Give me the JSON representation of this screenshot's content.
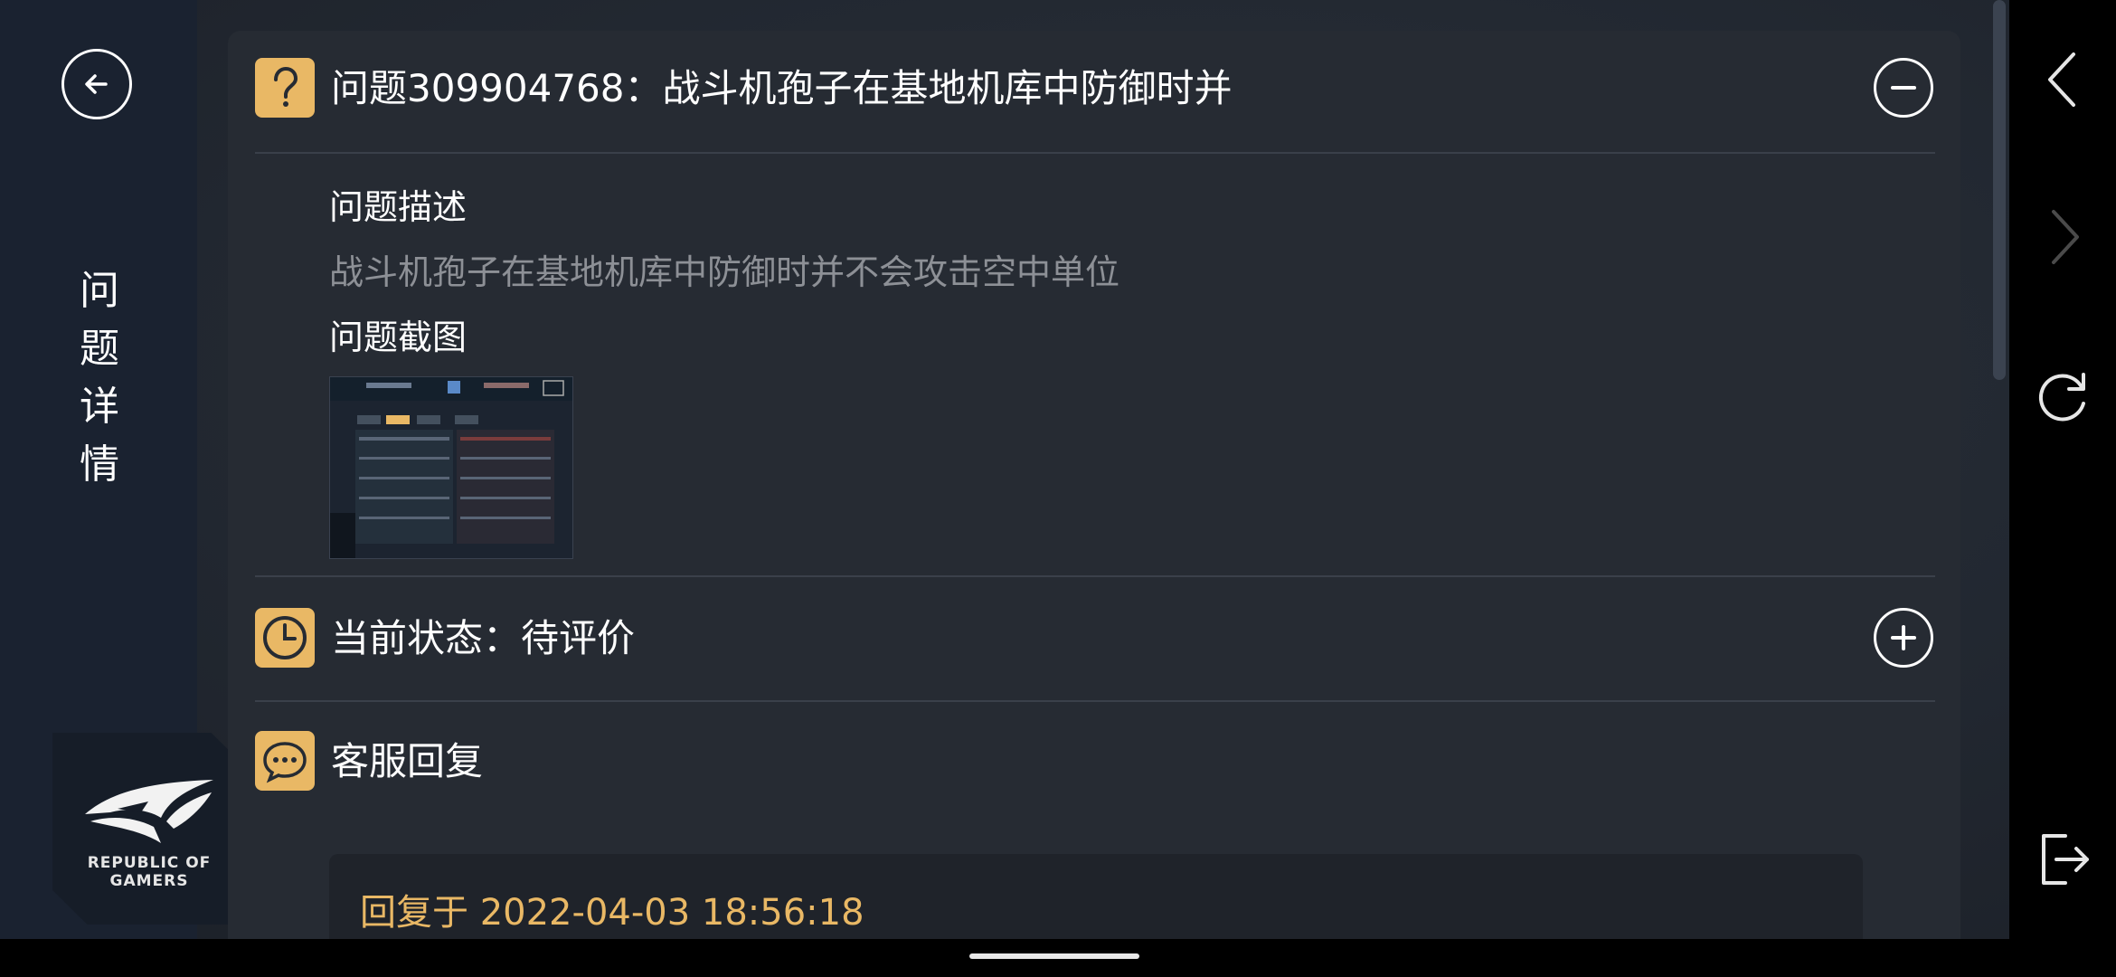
{
  "sidebar": {
    "title_chars": [
      "问",
      "题",
      "详",
      "情"
    ],
    "brand_line1": "REPUBLIC OF",
    "brand_line2": "GAMERS"
  },
  "issue": {
    "title": "问题309904768：战斗机孢子在基地机库中防御时并",
    "description_label": "问题描述",
    "description_text": "战斗机孢子在基地机库中防御时并不会攻击空中单位",
    "screenshot_label": "问题截图"
  },
  "status": {
    "text": "当前状态：待评价"
  },
  "support": {
    "title": "客服回复",
    "reply_time": "回复于 2022-04-03 18:56:18"
  },
  "colors": {
    "accent": "#e9b865",
    "card": "#262b33",
    "muted_text": "#8d9096"
  },
  "icons": {
    "back": "arrow-left-circle",
    "question": "question-mark",
    "collapse": "minus-circle",
    "status": "clock",
    "expand": "plus-circle",
    "chat": "chat-bubble",
    "nav_back": "chevron-left",
    "nav_forward": "chevron-right",
    "refresh": "refresh",
    "exit": "exit"
  }
}
